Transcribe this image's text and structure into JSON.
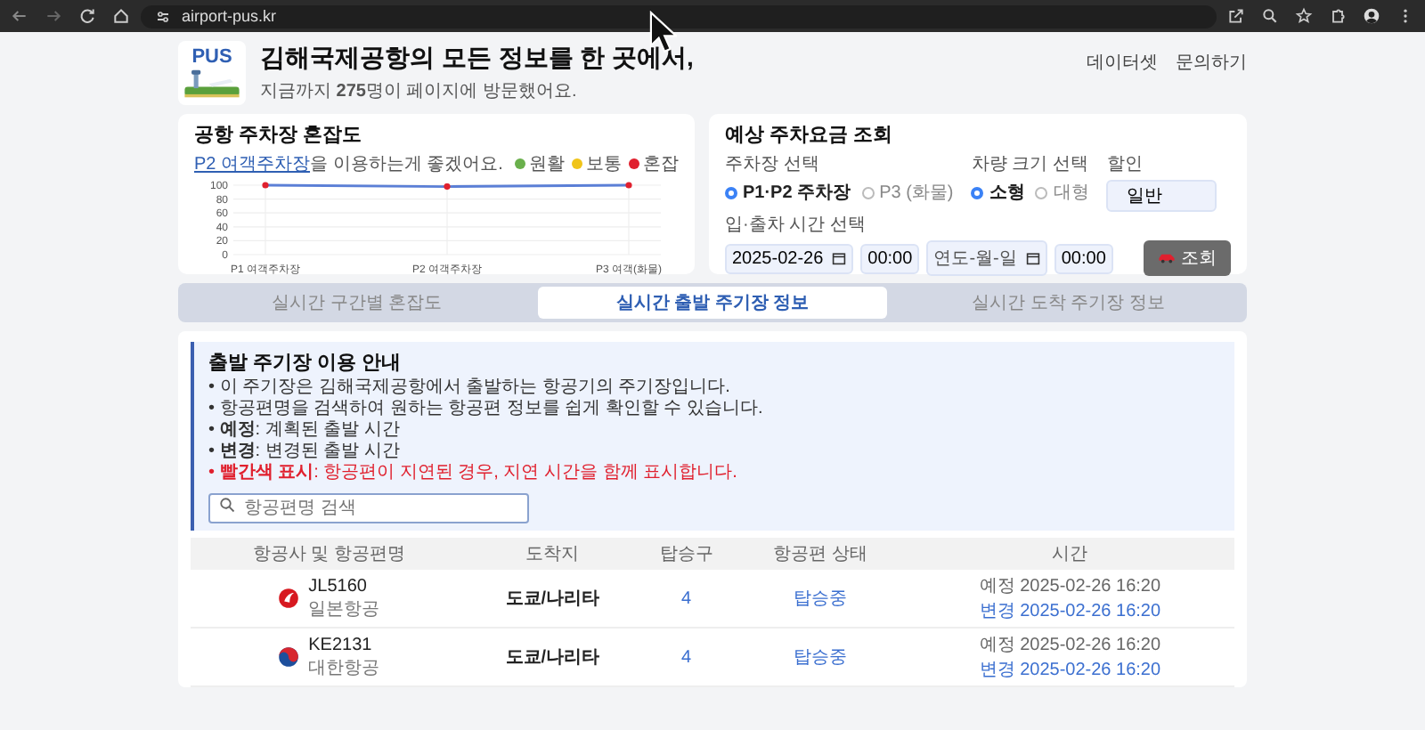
{
  "browser": {
    "url": "airport-pus.kr"
  },
  "header": {
    "logo": "PUS",
    "title": "김해국제공항의 모든 정보를 한 곳에서,",
    "subtitle": "지금까지 **275**명이 페이지에 방문했어요.",
    "nav": [
      "데이터셋",
      "문의하기"
    ]
  },
  "congestion": {
    "title": "공항 주차장 혼잡도",
    "link": "P2 여객주차장",
    "note": "을 이용하는게 좋겠어요.",
    "legend": [
      {
        "label": "원활",
        "color": "#6ab04c"
      },
      {
        "label": "보통",
        "color": "#f0c419"
      },
      {
        "label": "혼잡",
        "color": "#e0202e"
      }
    ],
    "chart_data": {
      "type": "line",
      "categories": [
        "P1 여객주차장",
        "P2 여객주차장",
        "P3 여객(화물)"
      ],
      "ylim": [
        0,
        100
      ],
      "yticks": [
        0,
        20,
        40,
        60,
        80,
        100
      ],
      "grid": true,
      "values": [
        100,
        98,
        100
      ]
    }
  },
  "fee": {
    "title": "예상 주차요금 조회",
    "lot_label": "주차장 선택",
    "lots": [
      {
        "label": "P1·P2 주차장",
        "selected": true
      },
      {
        "label": "P3 (화물)",
        "selected": false
      }
    ],
    "size_label": "차량 크기 선택",
    "sizes": [
      {
        "label": "소형",
        "selected": true
      },
      {
        "label": "대형",
        "selected": false
      }
    ],
    "discount_label": "할인",
    "discount": "일반",
    "time_label": "입·출차 시간 선택",
    "entry_date": "2025-02-26",
    "entry_time": "00:00",
    "exit_date_placeholder": "연도-월-일",
    "exit_time": "00:00",
    "button": "조회"
  },
  "tabs": [
    {
      "label": "실시간 구간별 혼잡도",
      "selected": false
    },
    {
      "label": "실시간 출발 주기장 정보",
      "selected": true
    },
    {
      "label": "실시간 도착 주기장 정보",
      "selected": false
    }
  ],
  "guide": {
    "title": "출발 주기장 이용 안내",
    "items": [
      {
        "text": "• 이 주기장은 김해국제공항에서 출발하는 항공기의 주기장입니다.",
        "kind": "normal"
      },
      {
        "text": "• 항공편명을 검색하여 원하는 항공편 정보를 쉽게 확인할 수 있습니다.",
        "kind": "normal"
      },
      {
        "text": "• **예정**: 계획된 출발 시간",
        "kind": "normal"
      },
      {
        "text": "• **변경**: 변경된 출발 시간",
        "kind": "normal"
      },
      {
        "text": "• **빨간색 표시**: 항공편이 지연된 경우, 지연 시간을 함께 표시합니다.",
        "kind": "warning"
      }
    ],
    "search_placeholder": "항공편명 검색"
  },
  "table": {
    "columns": [
      "항공사 및 항공편명",
      "도착지",
      "탑승구",
      "항공편 상태",
      "시간"
    ],
    "rows": [
      {
        "kind": "crane",
        "flight": "JL5160",
        "airline": "일본항공",
        "destination": "도쿄/나리타",
        "gate": "4",
        "status": "탑승중",
        "scheduled": "예정 2025-02-26 16:20",
        "changed": "변경 2025-02-26 16:20"
      },
      {
        "kind": "taegeuk",
        "flight": "KE2131",
        "airline": "대한항공",
        "destination": "도쿄/나리타",
        "gate": "4",
        "status": "탑승중",
        "scheduled": "예정 2025-02-26 16:20",
        "changed": "변경 2025-02-26 16:20"
      }
    ]
  }
}
